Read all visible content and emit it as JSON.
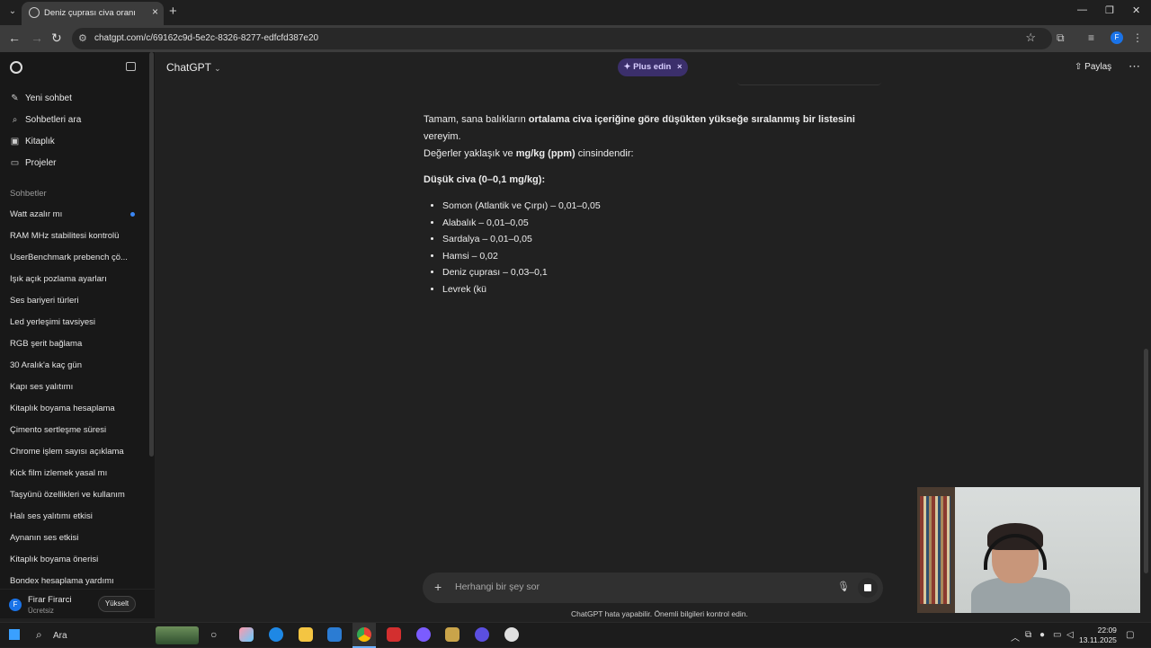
{
  "browser": {
    "tab_title": "Deniz çuprası civa oranı",
    "url": "chatgpt.com/c/69162c9d-5e2c-8326-8277-edfcfd387e20",
    "profile_initial": "F"
  },
  "sidebar": {
    "top_items": [
      "Yeni sohbet",
      "Sohbetleri ara",
      "Kitaplık",
      "Projeler"
    ],
    "section_label": "Sohbetler",
    "chats": [
      "Watt azalır mı",
      "RAM MHz stabilitesi kontrolü",
      "UserBenchmark prebench çö...",
      "Işık açık pozlama ayarları",
      "Ses bariyeri türleri",
      "Led yerleşimi tavsiyesi",
      "RGB şerit bağlama",
      "30 Aralık'a kaç gün",
      "Kapı ses yalıtımı",
      "Kitaplık boyama hesaplama",
      "Çimento sertleşme süresi",
      "Chrome işlem sayısı açıklama",
      "Kick film izlemek yasal mı",
      "Taşyünü özellikleri ve kullanım",
      "Halı ses yalıtımı etkisi",
      "Aynanın ses etkisi",
      "Kitaplık boyama önerisi",
      "Bondex hesaplama yardımı"
    ],
    "user": {
      "name": "Firar Firarci",
      "plan": "Ücretsiz",
      "initial": "F",
      "upgrade_label": "Yükselt"
    }
  },
  "header": {
    "model": "ChatGPT",
    "plus_label": "Plus edin",
    "share_label": "Paylaş"
  },
  "message": {
    "intro_1": "Tamam, sana balıkların ",
    "intro_bold": "ortalama civa içeriğine göre düşükten yükseğe sıralanmış bir listesini",
    "intro_2": " vereyim.",
    "line2_1": "Değerler yaklaşık ve ",
    "line2_bold": "mg/kg (ppm)",
    "line2_2": " cinsindendir:",
    "heading": "Düşük civa (0–0,1 mg/kg):",
    "items": [
      "Somon (Atlantik ve Çırpı) – 0,01–0,05",
      "Alabalık – 0,01–0,05",
      "Sardalya – 0,01–0,05",
      "Hamsi – 0,02",
      "Deniz çuprası – 0,03–0,1",
      "Levrek (kü"
    ]
  },
  "composer": {
    "placeholder": "Herhangi bir şey sor",
    "disclaimer": "ChatGPT hata yapabilir. Önemli bilgileri kontrol edin."
  },
  "taskbar": {
    "search_label": "Ara",
    "time": "22:09",
    "date": "13.11.2025"
  }
}
